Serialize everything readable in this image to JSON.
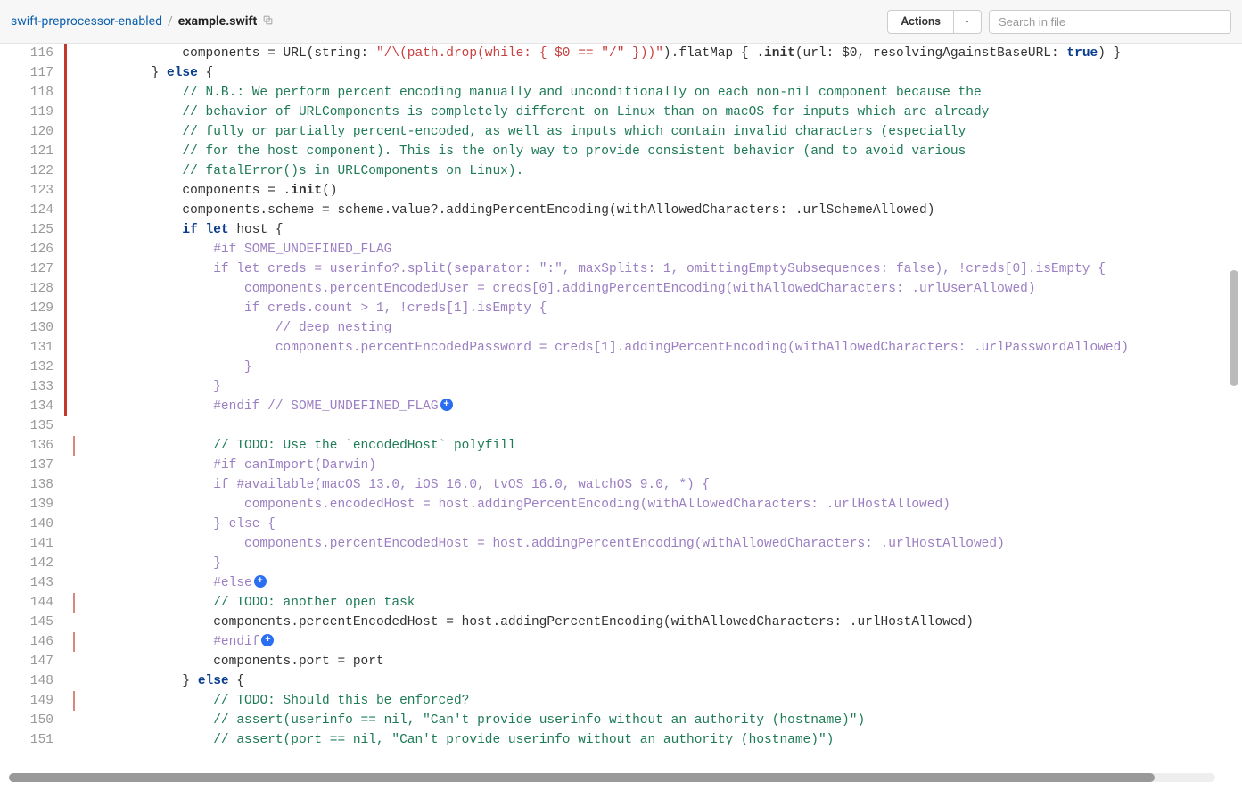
{
  "breadcrumb": {
    "repo": "swift-preprocessor-enabled",
    "file": "example.swift"
  },
  "header": {
    "actions_label": "Actions",
    "search_placeholder": "Search in file"
  },
  "lines": [
    {
      "n": 116,
      "markerStrong": true,
      "tokens": [
        [
          "id",
          "            "
        ],
        [
          "id",
          "components = URL(string: "
        ],
        [
          "str",
          "\"/\\(path.drop(while: { $0 == \"/\" }))\""
        ],
        [
          "id",
          ").flatMap { ."
        ],
        [
          "fn",
          "init"
        ],
        [
          "id",
          "(url: $0, resolvingAgainstBaseURL: "
        ],
        [
          "kw",
          "true"
        ],
        [
          "id",
          ") }"
        ]
      ]
    },
    {
      "n": 117,
      "markerStrong": true,
      "tokens": [
        [
          "id",
          "        } "
        ],
        [
          "kw",
          "else"
        ],
        [
          "id",
          " {"
        ]
      ]
    },
    {
      "n": 118,
      "markerStrong": true,
      "tokens": [
        [
          "id",
          "            "
        ],
        [
          "com",
          "// N.B.: We perform percent encoding manually and unconditionally on each non-nil component because the"
        ]
      ]
    },
    {
      "n": 119,
      "markerStrong": true,
      "tokens": [
        [
          "id",
          "            "
        ],
        [
          "com",
          "// behavior of URLComponents is completely different on Linux than on macOS for inputs which are already"
        ]
      ]
    },
    {
      "n": 120,
      "markerStrong": true,
      "tokens": [
        [
          "id",
          "            "
        ],
        [
          "com",
          "// fully or partially percent-encoded, as well as inputs which contain invalid characters (especially"
        ]
      ]
    },
    {
      "n": 121,
      "markerStrong": true,
      "tokens": [
        [
          "id",
          "            "
        ],
        [
          "com",
          "// for the host component). This is the only way to provide consistent behavior (and to avoid various"
        ]
      ]
    },
    {
      "n": 122,
      "markerStrong": true,
      "tokens": [
        [
          "id",
          "            "
        ],
        [
          "com",
          "// fatalError()s in URLComponents on Linux)."
        ]
      ]
    },
    {
      "n": 123,
      "markerStrong": true,
      "tokens": [
        [
          "id",
          "            components = ."
        ],
        [
          "fn",
          "init"
        ],
        [
          "id",
          "()"
        ]
      ]
    },
    {
      "n": 124,
      "markerStrong": true,
      "tokens": [
        [
          "id",
          "            components.scheme = scheme.value?.addingPercentEncoding(withAllowedCharacters: .urlSchemeAllowed)"
        ]
      ]
    },
    {
      "n": 125,
      "markerStrong": true,
      "tokens": [
        [
          "id",
          "            "
        ],
        [
          "kw",
          "if"
        ],
        [
          "id",
          " "
        ],
        [
          "kw",
          "let"
        ],
        [
          "id",
          " host {"
        ]
      ]
    },
    {
      "n": 126,
      "markerStrong": true,
      "tokens": [
        [
          "id",
          "                "
        ],
        [
          "dim",
          "#if SOME_UNDEFINED_FLAG"
        ]
      ]
    },
    {
      "n": 127,
      "markerStrong": true,
      "tokens": [
        [
          "id",
          "                "
        ],
        [
          "dim",
          "if let creds = userinfo?.split(separator: \":\", maxSplits: 1, omittingEmptySubsequences: false), !creds[0].isEmpty {"
        ]
      ]
    },
    {
      "n": 128,
      "markerStrong": true,
      "tokens": [
        [
          "id",
          "                    "
        ],
        [
          "dim",
          "components.percentEncodedUser = creds[0].addingPercentEncoding(withAllowedCharacters: .urlUserAllowed)"
        ]
      ]
    },
    {
      "n": 129,
      "markerStrong": true,
      "tokens": [
        [
          "id",
          "                    "
        ],
        [
          "dim",
          "if creds.count > 1, !creds[1].isEmpty {"
        ]
      ]
    },
    {
      "n": 130,
      "markerStrong": true,
      "tokens": [
        [
          "id",
          "                        "
        ],
        [
          "dim",
          "// deep nesting"
        ]
      ]
    },
    {
      "n": 131,
      "markerStrong": true,
      "tokens": [
        [
          "id",
          "                        "
        ],
        [
          "dim",
          "components.percentEncodedPassword = creds[1].addingPercentEncoding(withAllowedCharacters: .urlPasswordAllowed)"
        ]
      ]
    },
    {
      "n": 132,
      "markerStrong": true,
      "tokens": [
        [
          "id",
          "                    "
        ],
        [
          "dim",
          "}"
        ]
      ]
    },
    {
      "n": 133,
      "markerStrong": true,
      "tokens": [
        [
          "id",
          "                "
        ],
        [
          "dim",
          "}"
        ]
      ]
    },
    {
      "n": 134,
      "markerStrong": true,
      "badge": true,
      "tokens": [
        [
          "id",
          "                "
        ],
        [
          "dim",
          "#endif // SOME_UNDEFINED_FLAG"
        ]
      ]
    },
    {
      "n": 135,
      "tokens": []
    },
    {
      "n": 136,
      "markerLight": true,
      "tokens": [
        [
          "id",
          "                "
        ],
        [
          "com",
          "// TODO: Use the `encodedHost` polyfill"
        ]
      ]
    },
    {
      "n": 137,
      "tokens": [
        [
          "id",
          "                "
        ],
        [
          "dim",
          "#if canImport(Darwin)"
        ]
      ]
    },
    {
      "n": 138,
      "tokens": [
        [
          "id",
          "                "
        ],
        [
          "dim",
          "if #available(macOS 13.0, iOS 16.0, tvOS 16.0, watchOS 9.0, *) {"
        ]
      ]
    },
    {
      "n": 139,
      "tokens": [
        [
          "id",
          "                    "
        ],
        [
          "dim",
          "components.encodedHost = host.addingPercentEncoding(withAllowedCharacters: .urlHostAllowed)"
        ]
      ]
    },
    {
      "n": 140,
      "tokens": [
        [
          "id",
          "                "
        ],
        [
          "dim",
          "} else {"
        ]
      ]
    },
    {
      "n": 141,
      "tokens": [
        [
          "id",
          "                    "
        ],
        [
          "dim",
          "components.percentEncodedHost = host.addingPercentEncoding(withAllowedCharacters: .urlHostAllowed)"
        ]
      ]
    },
    {
      "n": 142,
      "tokens": [
        [
          "id",
          "                "
        ],
        [
          "dim",
          "}"
        ]
      ]
    },
    {
      "n": 143,
      "badge": true,
      "tokens": [
        [
          "id",
          "                "
        ],
        [
          "dim",
          "#else"
        ]
      ]
    },
    {
      "n": 144,
      "markerLight": true,
      "tokens": [
        [
          "id",
          "                "
        ],
        [
          "com",
          "// TODO: another open task"
        ]
      ]
    },
    {
      "n": 145,
      "tokens": [
        [
          "id",
          "                components.percentEncodedHost = host.addingPercentEncoding(withAllowedCharacters: .urlHostAllowed)"
        ]
      ]
    },
    {
      "n": 146,
      "markerLight": true,
      "badge": true,
      "tokens": [
        [
          "id",
          "                "
        ],
        [
          "dim",
          "#endif"
        ]
      ]
    },
    {
      "n": 147,
      "tokens": [
        [
          "id",
          "                components.port = port"
        ]
      ]
    },
    {
      "n": 148,
      "tokens": [
        [
          "id",
          "            } "
        ],
        [
          "kw",
          "else"
        ],
        [
          "id",
          " {"
        ]
      ]
    },
    {
      "n": 149,
      "markerLight": true,
      "tokens": [
        [
          "id",
          "                "
        ],
        [
          "com",
          "// TODO: Should this be enforced?"
        ]
      ]
    },
    {
      "n": 150,
      "tokens": [
        [
          "id",
          "                "
        ],
        [
          "com",
          "// assert(userinfo == nil, \"Can't provide userinfo without an authority (hostname)\")"
        ]
      ]
    },
    {
      "n": 151,
      "tokens": [
        [
          "id",
          "                "
        ],
        [
          "com",
          "// assert(port == nil, \"Can't provide userinfo without an authority (hostname)\")"
        ]
      ]
    }
  ]
}
